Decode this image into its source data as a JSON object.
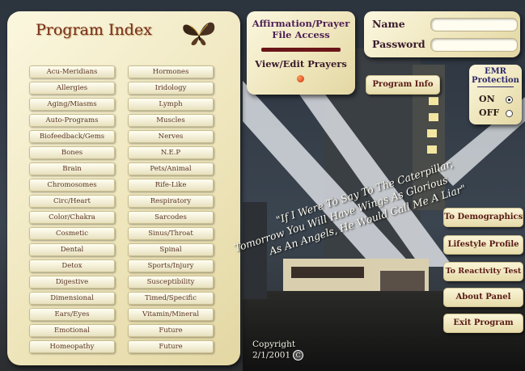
{
  "index": {
    "title": "Program Index",
    "left_column": [
      "Acu-Meridians",
      "Allergies",
      "Aging/Miasms",
      "Auto-Programs",
      "Biofeedback/Gems",
      "Bones",
      "Brain",
      "Chromosomes",
      "Circ/Heart",
      "Color/Chakra",
      "Cosmetic",
      "Dental",
      "Detox",
      "Digestive",
      "Dimensional",
      "Ears/Eyes",
      "Emotional",
      "Homeopathy"
    ],
    "right_column": [
      "Hormones",
      "Iridology",
      "Lymph",
      "Muscles",
      "Nerves",
      "N.E.P",
      "Pets/Animal",
      "Rife-Like",
      "Respiratory",
      "Sarcodes",
      "Sinus/Throat",
      "Spinal",
      "Sports/Injury",
      "Susceptibility",
      "Timed/Specific",
      "Vitamin/Mineral",
      "Future",
      "Future"
    ]
  },
  "affirmation": {
    "title_line1": "Affirmation/Prayer",
    "title_line2": "File Access",
    "view_edit": "View/Edit Prayers"
  },
  "login": {
    "name_label": "Name",
    "password_label": "Password",
    "name_value": "",
    "password_value": ""
  },
  "program_info": "Program Info",
  "emr": {
    "title_line1": "EMR",
    "title_line2": "Protection",
    "on": "ON",
    "off": "OFF",
    "selected": "ON"
  },
  "quote": {
    "line1": "\"If I Were To Say To The Caterpillar,",
    "line2": "Tomorrow You Will Have Wings As Glorious",
    "line3": "As An Angels, He Would Call Me A Liar\""
  },
  "right_buttons": [
    "To Demographics",
    "Lifestyle Profile",
    "To Reactivity Test",
    "About Panel",
    "Exit Program"
  ],
  "copyright": {
    "line1": "Copyright",
    "line2": "2/1/2001",
    "symbol": "C"
  },
  "colors": {
    "panel": "#f2ebc8",
    "dot": "#8b1a12",
    "button_text": "#5a1a16"
  }
}
